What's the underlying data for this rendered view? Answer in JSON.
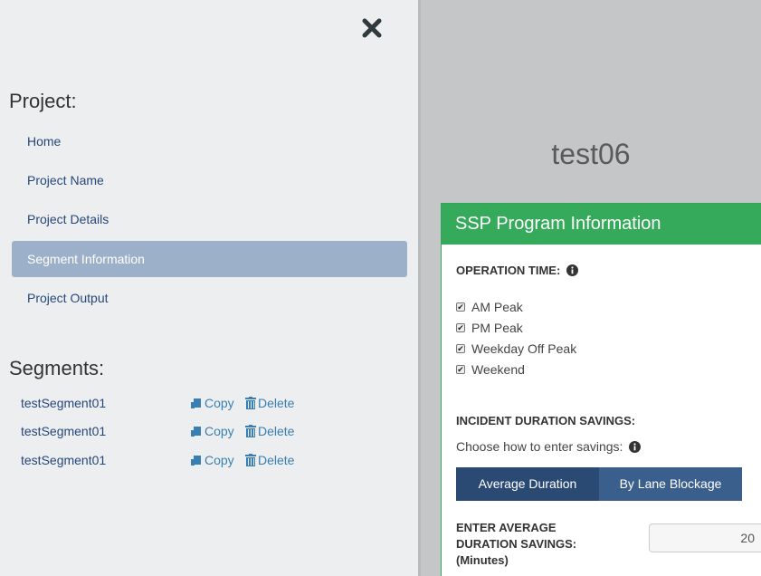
{
  "sidebar": {
    "close_icon": "close-icon",
    "project_heading": "Project:",
    "nav": [
      {
        "label": "Home",
        "active": false
      },
      {
        "label": "Project Name",
        "active": false
      },
      {
        "label": "Project Details",
        "active": false
      },
      {
        "label": "Segment Information",
        "active": true
      },
      {
        "label": "Project Output",
        "active": false
      }
    ],
    "segments_heading": "Segments:",
    "segments": [
      {
        "name": "testSegment01",
        "copy": "Copy",
        "delete": "Delete"
      },
      {
        "name": "testSegment01",
        "copy": "Copy",
        "delete": "Delete"
      },
      {
        "name": "testSegment01",
        "copy": "Copy",
        "delete": "Delete"
      }
    ]
  },
  "main": {
    "project_title": "test06",
    "panel": {
      "title": "SSP Program Information",
      "operation_time_label": "OPERATION TIME:",
      "operation_options": [
        {
          "label": "AM Peak",
          "checked": true
        },
        {
          "label": "PM Peak",
          "checked": true
        },
        {
          "label": "Weekday Off Peak",
          "checked": true
        },
        {
          "label": "Weekend",
          "checked": true
        }
      ],
      "incident_label": "INCIDENT DURATION SAVINGS:",
      "choose_text": "Choose how to enter savings:",
      "toggle": [
        {
          "label": "Average Duration",
          "active": true
        },
        {
          "label": "By Lane Blockage",
          "active": false
        }
      ],
      "enter_label": "ENTER AVERAGE DURATION SAVINGS: (Minutes)",
      "duration_value": "20"
    }
  },
  "colors": {
    "sidebar_bg": "#eceeef",
    "active_nav": "#9cb1c9",
    "panel_header": "#35aa5b",
    "toggle_bg": "#3b5f8c",
    "link": "#26477a"
  }
}
